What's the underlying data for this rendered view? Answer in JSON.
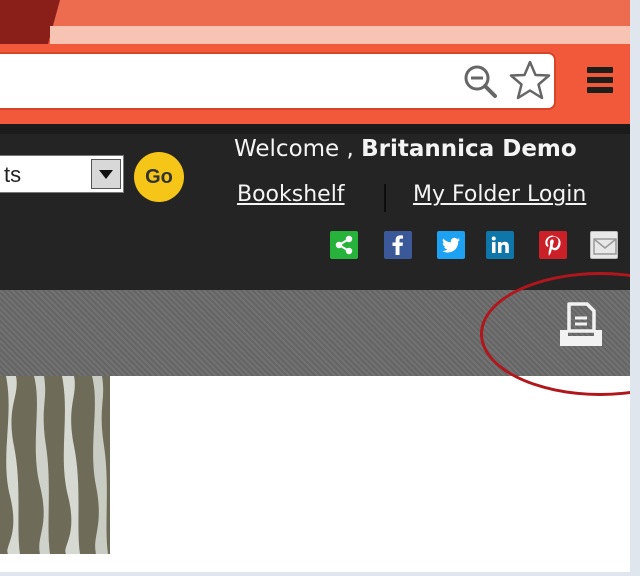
{
  "browser": {
    "menu_label": "≡"
  },
  "header": {
    "select_value": "ts",
    "go_label": "Go",
    "welcome_prefix": "Welcome ,",
    "user_name": "Britannica Demo",
    "bookshelf_link": "Bookshelf",
    "folder_link": "My Folder Login"
  },
  "share": {
    "icons": [
      "share-icon",
      "facebook-icon",
      "twitter-icon",
      "linkedin-icon",
      "pinterest-icon",
      "email-icon"
    ]
  },
  "toolbar": {
    "print_icon": "print-icon"
  },
  "colors": {
    "chrome_accent": "#f2583a",
    "header_bg": "#242424",
    "go_button": "#f5c518",
    "annotation_circle": "#b0161b",
    "share_green": "#27b33b",
    "facebook_blue": "#3b5998",
    "twitter_blue": "#1da1f2",
    "linkedin_blue": "#0e76a8",
    "pinterest_red": "#cb2027"
  }
}
